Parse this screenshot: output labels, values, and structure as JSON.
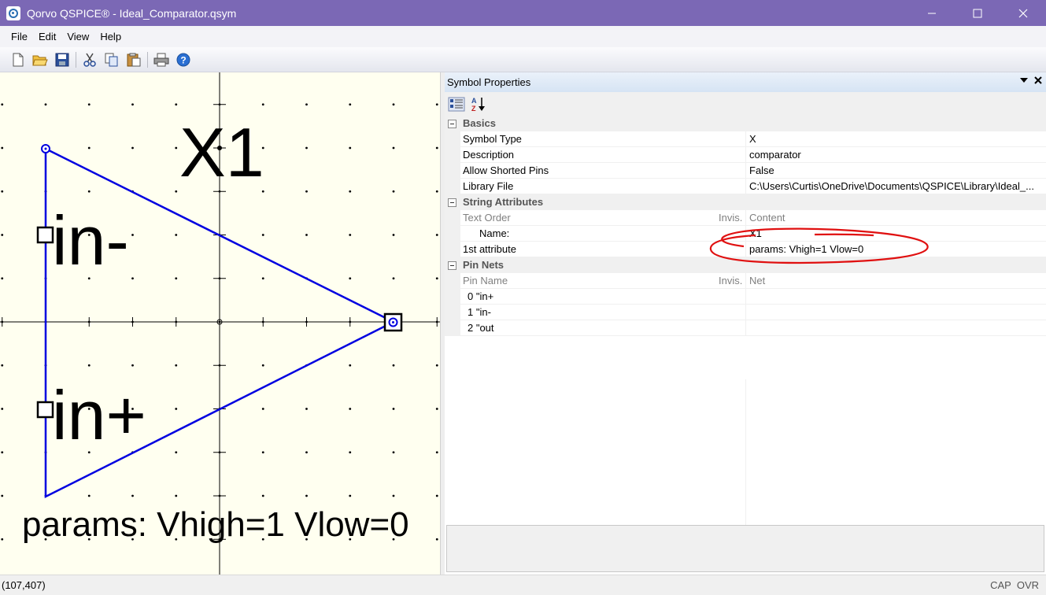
{
  "window": {
    "title": "Qorvo QSPICE® - Ideal_Comparator.qsym",
    "app_icon": "qspice-icon"
  },
  "menu": [
    "File",
    "Edit",
    "View",
    "Help"
  ],
  "toolbar": {
    "icons": [
      "new-file-icon",
      "open-folder-icon",
      "save-icon",
      "cut-icon",
      "copy-icon",
      "paste-icon",
      "print-icon",
      "help-icon"
    ]
  },
  "symbol": {
    "ref_label": "X1",
    "pin_in_minus_label": "in-",
    "pin_in_plus_label": "in+",
    "params_label": "params: Vhigh=1 Vlow=0",
    "outline_color": "#0000e0",
    "canvas_bg": "#fffff0"
  },
  "properties": {
    "pane_title": "Symbol Properties",
    "basics": {
      "title": "Basics",
      "rows": [
        {
          "name": "Symbol Type",
          "value": "X"
        },
        {
          "name": "Description",
          "value": "comparator"
        },
        {
          "name": "Allow Shorted Pins",
          "value": "False"
        },
        {
          "name": "Library File",
          "value": "C:\\Users\\Curtis\\OneDrive\\Documents\\QSPICE\\Library\\Ideal_..."
        }
      ]
    },
    "string_attributes": {
      "title": "String Attributes",
      "header": {
        "name": "Text Order",
        "invis": "Invis.",
        "value": "Content"
      },
      "rows": [
        {
          "name": "Name:",
          "value": "X1"
        },
        {
          "name": "1st attribute",
          "value": "params: Vhigh=1 Vlow=0"
        }
      ]
    },
    "pin_nets": {
      "title": "Pin Nets",
      "header": {
        "name": "Pin Name",
        "invis": "Invis.",
        "value": "Net"
      },
      "rows": [
        {
          "name": "0 \"in+",
          "value": ""
        },
        {
          "name": "1 \"in-",
          "value": ""
        },
        {
          "name": "2 \"out",
          "value": ""
        }
      ]
    },
    "highlight_color": "#e01010"
  },
  "status": {
    "coords": "(107,407)",
    "cap": "CAP",
    "ovr": "OVR"
  }
}
